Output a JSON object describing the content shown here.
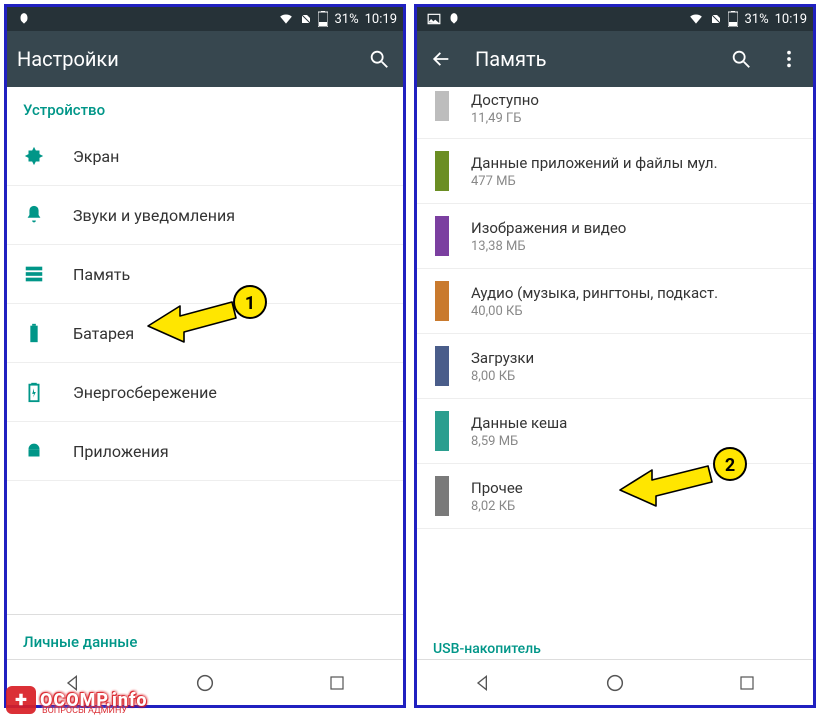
{
  "status": {
    "battery_pct": "31%",
    "time": "10:19"
  },
  "left": {
    "title": "Настройки",
    "section1": "Устройство",
    "items": [
      {
        "label": "Экран"
      },
      {
        "label": "Звуки и уведомления"
      },
      {
        "label": "Память"
      },
      {
        "label": "Батарея"
      },
      {
        "label": "Энергосбережение"
      },
      {
        "label": "Приложения"
      }
    ],
    "section2": "Личные данные"
  },
  "right": {
    "title": "Память",
    "items": [
      {
        "label": "Доступно",
        "sub": "11,49 ГБ",
        "color": "#bdbdbd"
      },
      {
        "label": "Данные приложений и файлы мул.",
        "sub": "477 МБ",
        "color": "#6b8e23"
      },
      {
        "label": "Изображения и видео",
        "sub": "13,38 МБ",
        "color": "#7b3fa0"
      },
      {
        "label": "Аудио (музыка, рингтоны, подкаст.",
        "sub": "40,00 КБ",
        "color": "#c97a2e"
      },
      {
        "label": "Загрузки",
        "sub": "8,00 КБ",
        "color": "#4a5d8a"
      },
      {
        "label": "Данные кеша",
        "sub": "8,59 МБ",
        "color": "#2b9e8f"
      },
      {
        "label": "Прочее",
        "sub": "8,02 КБ",
        "color": "#7a7a7a"
      }
    ],
    "usb_header": "USB-накопитель"
  },
  "callouts": {
    "one": "1",
    "two": "2"
  },
  "watermark": {
    "main": "OCOMP.info",
    "sub": "ВОПРОСЫ АДМИНУ"
  }
}
